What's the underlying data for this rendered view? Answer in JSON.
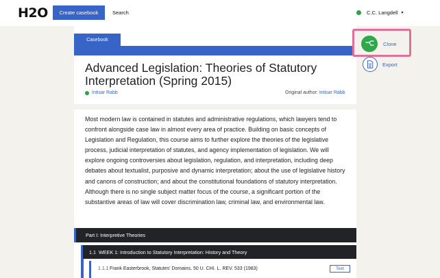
{
  "header": {
    "logo": "H2O",
    "create_button": "Create casebook",
    "search_link": "Search",
    "user_name": "C.C. Langdell"
  },
  "casebook": {
    "tab_label": "Casebook",
    "title": "Advanced Legislation: Theories of Statutory Interpretation (Spring 2015)",
    "author": "Intisar Rabb",
    "original_author_label": "Original author:",
    "original_author_name": "Intisar Rabb",
    "description": "Most modern law is contained in statutes and administrative regulations, which lawyers tend to confront alongside case law in almost every area of practice. Building on basic concepts of Legislation and Regulation, this course aims to further explore the theories of the legislative process, judicial interpretation of statutes, and agency implementation of legislation. We will explore ongoing controversies about legislation, regulation, and interpretation, including deep debates about textualist, purposive and dynamic interpretation; about the use of legislative history and canons of construction; and about the constitutional foundations of statutory interpretation. Although there is no single subject matter focus of the course, a significant portion of the substantive areas of law will cover discrimination law, criminal law, and environmental law."
  },
  "actions": {
    "clone_label": "Clone",
    "export_label": "Export"
  },
  "toc": {
    "part_title": "Part I: Interpretive Theories",
    "week_number": "1.1",
    "week_title": "WEEK 1: Introduction to Statutory Interpretation: History and Theory",
    "resource_number": "1.1.1",
    "resource_title": "Frank Easterbrook, Statutes' Domains, 50 U. CHI. L. REV. 533 (1983)",
    "resource_type": "Text"
  },
  "colors": {
    "accent": "#3764c6",
    "clone_green": "#2ea84a",
    "highlight": "#e0709a",
    "dark_row": "#222326"
  }
}
